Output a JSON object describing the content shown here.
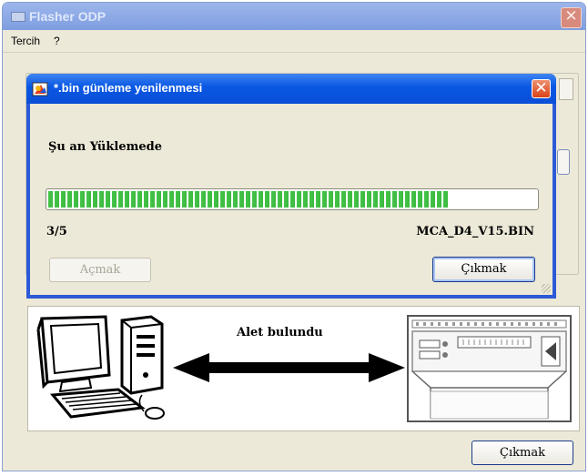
{
  "main_window": {
    "title": "Flasher ODP",
    "close_symbol": "✕",
    "menu": [
      "Tercih",
      "?"
    ],
    "device_status": "Alet bulundu",
    "exit_label": "Çıkmak",
    "icons": [
      "app-icon",
      "computer-icon",
      "double-arrow-icon",
      "device-icon"
    ]
  },
  "dialog": {
    "title": "*.bin günleme yenilenmesi",
    "close_symbol": "✕",
    "status": "Şu an Yüklemede",
    "progress_fraction": 0.82,
    "count": "3/5",
    "filename": "MCA_D4_V15.BIN",
    "open_label": "Açmak",
    "exit_label": "Çıkmak",
    "icons": [
      "update-icon",
      "close-icon",
      "resize-grip-icon"
    ]
  },
  "colors": {
    "dialog_titlebar": "#0857e3",
    "progress": "#3bba3e",
    "window_bg": "#ece9d8"
  }
}
